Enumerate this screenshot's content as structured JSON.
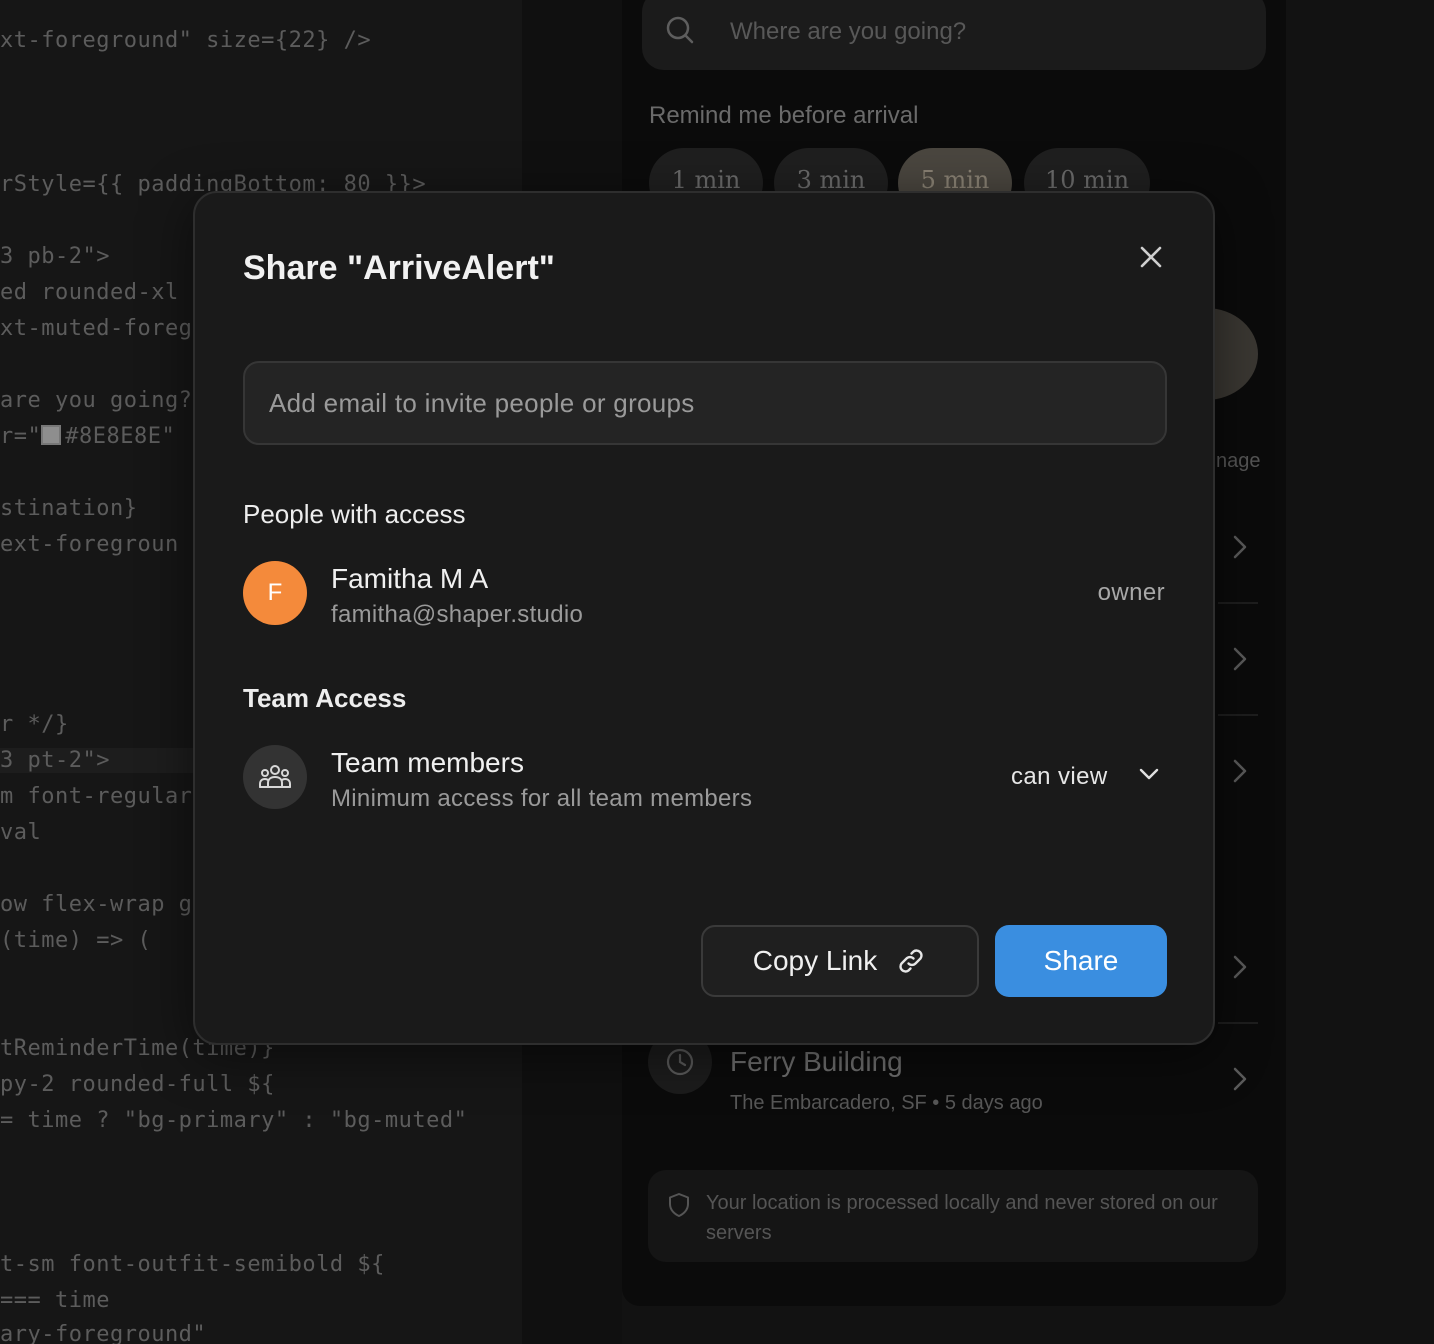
{
  "editor": {
    "lines": [
      "xt-foreground\" size={22} />",
      "rStyle={{ paddingBottom: 80 }}>",
      "3 pb-2\">",
      "ed rounded-xl",
      "xt-muted-foreg",
      "are you going?",
      "r=\"",
      "#8E8E8E\"",
      "stination}",
      "ext-foregroun",
      "r */}",
      "3 pt-2\">",
      "m font-regular",
      "val",
      "ow flex-wrap g",
      "(time) => (",
      "tReminderTime(time)}",
      "py-2 rounded-full ${",
      "= time ? \"bg-primary\" : \"bg-muted\"",
      "t-sm font-outfit-semibold ${",
      "=== time",
      "ary-foreground\""
    ]
  },
  "phone": {
    "search_placeholder": "Where are you going?",
    "remind_label": "Remind me before arrival",
    "chips": [
      "1 min",
      "3 min",
      "5 min",
      "10 min"
    ],
    "active_chip": "5 min",
    "manage_label": "nage",
    "recent": {
      "title": "Ferry Building",
      "subtitle": "The Embarcadero, SF • 5 days ago"
    },
    "notice": "Your location is processed locally and never stored on our servers"
  },
  "modal": {
    "title": "Share \"ArriveAlert\"",
    "invite_placeholder": "Add email to invite people or groups",
    "people_heading": "People with access",
    "owner": {
      "initial": "F",
      "name": "Famitha M A",
      "email": "famitha@shaper.studio",
      "role": "owner"
    },
    "team_heading": "Team Access",
    "team": {
      "name": "Team members",
      "description": "Minimum access for all team members",
      "permission": "can view"
    },
    "copy_link_label": "Copy Link",
    "share_label": "Share"
  },
  "colors": {
    "accent": "#3a8ee0",
    "avatar": "#f48a3b",
    "modal_bg": "#1a1a1a"
  }
}
